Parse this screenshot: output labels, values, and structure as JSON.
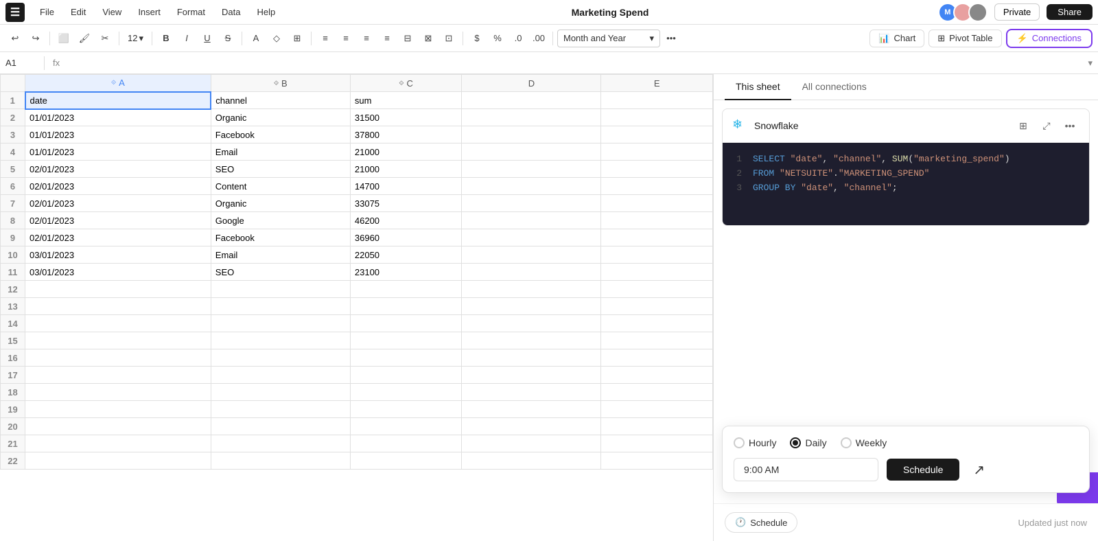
{
  "app": {
    "title": "Marketing Spend",
    "visibility": "Private",
    "share_label": "Share"
  },
  "menu": {
    "items": [
      "File",
      "Edit",
      "View",
      "Insert",
      "Format",
      "Data",
      "Help"
    ]
  },
  "toolbar": {
    "font_size": "12",
    "format_label": "Month and Year",
    "chart_label": "Chart",
    "pivot_label": "Pivot Table",
    "connections_label": "Connections"
  },
  "cell_bar": {
    "ref": "A1",
    "fx": "fx"
  },
  "columns": {
    "headers": [
      "A",
      "B",
      "C",
      "D",
      "E"
    ]
  },
  "rows": [
    {
      "row": 1,
      "a": "date",
      "b": "channel",
      "c": "sum",
      "d": "",
      "e": ""
    },
    {
      "row": 2,
      "a": "01/01/2023",
      "b": "Organic",
      "c": "31500",
      "d": "",
      "e": ""
    },
    {
      "row": 3,
      "a": "01/01/2023",
      "b": "Facebook",
      "c": "37800",
      "d": "",
      "e": ""
    },
    {
      "row": 4,
      "a": "01/01/2023",
      "b": "Email",
      "c": "21000",
      "d": "",
      "e": ""
    },
    {
      "row": 5,
      "a": "02/01/2023",
      "b": "SEO",
      "c": "21000",
      "d": "",
      "e": ""
    },
    {
      "row": 6,
      "a": "02/01/2023",
      "b": "Content",
      "c": "14700",
      "d": "",
      "e": ""
    },
    {
      "row": 7,
      "a": "02/01/2023",
      "b": "Organic",
      "c": "33075",
      "d": "",
      "e": ""
    },
    {
      "row": 8,
      "a": "02/01/2023",
      "b": "Google",
      "c": "46200",
      "d": "",
      "e": ""
    },
    {
      "row": 9,
      "a": "02/01/2023",
      "b": "Facebook",
      "c": "36960",
      "d": "",
      "e": ""
    },
    {
      "row": 10,
      "a": "03/01/2023",
      "b": "Email",
      "c": "22050",
      "d": "",
      "e": ""
    },
    {
      "row": 11,
      "a": "03/01/2023",
      "b": "SEO",
      "c": "23100",
      "d": "",
      "e": ""
    },
    {
      "row": 12,
      "a": "",
      "b": "",
      "c": "",
      "d": "",
      "e": ""
    },
    {
      "row": 13,
      "a": "",
      "b": "",
      "c": "",
      "d": "",
      "e": ""
    },
    {
      "row": 14,
      "a": "",
      "b": "",
      "c": "",
      "d": "",
      "e": ""
    },
    {
      "row": 15,
      "a": "",
      "b": "",
      "c": "",
      "d": "",
      "e": ""
    },
    {
      "row": 16,
      "a": "",
      "b": "",
      "c": "",
      "d": "",
      "e": ""
    },
    {
      "row": 17,
      "a": "",
      "b": "",
      "c": "",
      "d": "",
      "e": ""
    },
    {
      "row": 18,
      "a": "",
      "b": "",
      "c": "",
      "d": "",
      "e": ""
    },
    {
      "row": 19,
      "a": "",
      "b": "",
      "c": "",
      "d": "",
      "e": ""
    },
    {
      "row": 20,
      "a": "",
      "b": "",
      "c": "",
      "d": "",
      "e": ""
    },
    {
      "row": 21,
      "a": "",
      "b": "",
      "c": "",
      "d": "",
      "e": ""
    },
    {
      "row": 22,
      "a": "",
      "b": "",
      "c": "",
      "d": "",
      "e": ""
    }
  ],
  "right_panel": {
    "tabs": [
      "This sheet",
      "All connections"
    ],
    "active_tab": "This sheet"
  },
  "connection": {
    "name": "Snowflake",
    "sql": {
      "line1": {
        "keyword1": "SELECT",
        "str1": "\"date\"",
        "str2": "\"channel\"",
        "func1": "SUM",
        "str3": "\"marketing_spend\""
      },
      "line2": {
        "keyword1": "FROM",
        "str1": "\"NETSUITE\"",
        "str2": "\"MARKETING_SPEND\""
      },
      "line3": {
        "keyword1": "GROUP BY",
        "str1": "\"date\"",
        "str2": "\"channel\""
      }
    }
  },
  "schedule_popup": {
    "hourly_label": "Hourly",
    "daily_label": "Daily",
    "weekly_label": "Weekly",
    "daily_checked": true,
    "time_value": "9:00 AM",
    "schedule_btn_label": "Schedule"
  },
  "bottom_bar": {
    "schedule_label": "Schedule",
    "updated_text": "Updated just now"
  }
}
